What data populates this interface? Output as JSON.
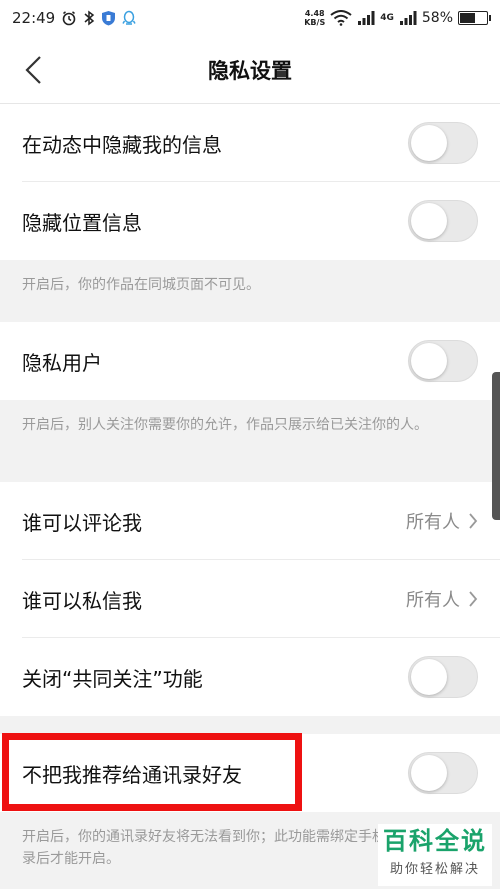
{
  "status_bar": {
    "time": "22:49",
    "net_speed_value": "4.48",
    "net_speed_unit": "KB/S",
    "signal_label_1": "4G",
    "battery_percent": "58%",
    "battery_level": 0.58
  },
  "nav": {
    "title": "隐私设置"
  },
  "rows": {
    "hide_in_feed": "在动态中隐藏我的信息",
    "hide_location": "隐藏位置信息",
    "private_user": "隐私用户",
    "who_can_comment": "谁可以评论我",
    "who_can_comment_value": "所有人",
    "who_can_message": "谁可以私信我",
    "who_can_message_value": "所有人",
    "close_mutual_follow": "关闭“共同关注”功能",
    "no_recommend_contacts": "不把我推荐给通讯录好友"
  },
  "notes": {
    "location_note": "开启后，你的作品在同城页面不可见。",
    "private_note": "开启后，别人关注你需要你的允许，作品只展示给已关注你的人。",
    "contacts_note": "开启后，你的通讯录好友将无法看到你；此功能需绑定手机号并关联通讯录后才能开启。"
  },
  "toggles": {
    "hide_in_feed": false,
    "hide_location": false,
    "private_user": false,
    "close_mutual_follow": false,
    "no_recommend_contacts": false
  },
  "watermark": {
    "title": "百科全说",
    "subtitle": "助你轻松解决"
  }
}
